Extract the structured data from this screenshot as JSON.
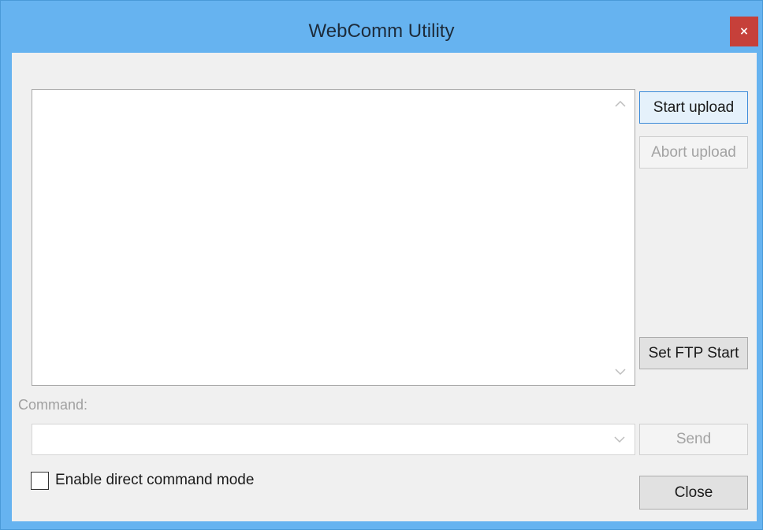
{
  "window": {
    "title": "WebComm Utility",
    "close_glyph": "×"
  },
  "buttons": {
    "start_upload": "Start upload",
    "abort_upload": "Abort upload",
    "set_ftp_start": "Set FTP Start",
    "send": "Send",
    "close": "Close"
  },
  "command": {
    "label": "Command:",
    "value": ""
  },
  "direct_mode": {
    "label": "Enable direct command mode",
    "checked": false
  },
  "icons": {
    "scroll_up": "chevron-up-icon",
    "scroll_down": "chevron-down-icon",
    "combo_arrow": "chevron-down-icon"
  },
  "colors": {
    "titlebar": "#66b3f0",
    "close_button": "#c6403a",
    "client_bg": "#f0f0f0",
    "disabled_text": "#a3a3a3"
  }
}
